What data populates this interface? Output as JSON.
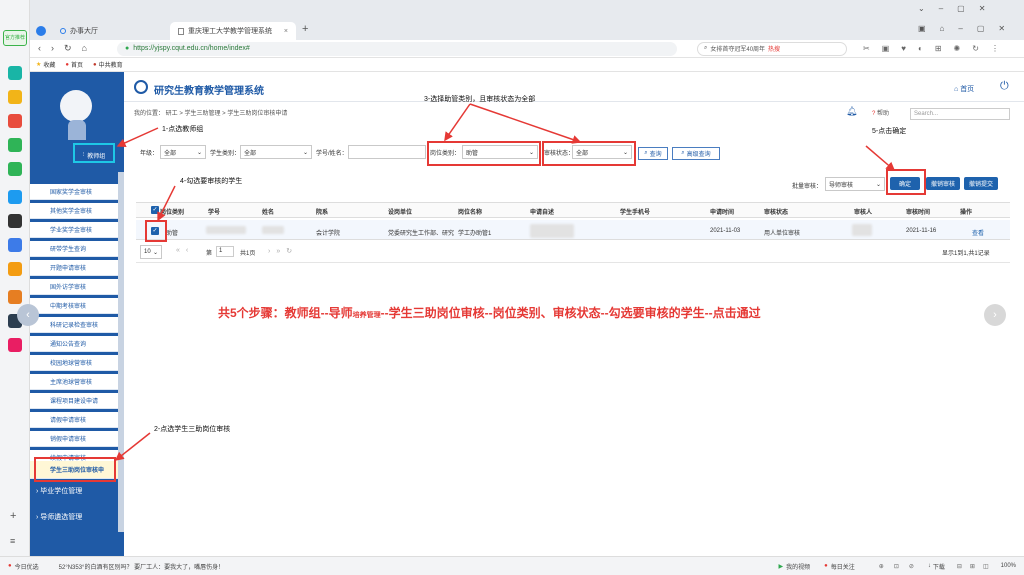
{
  "browser": {
    "tabs": [
      {
        "label": "办事大厅"
      },
      {
        "label": "重庆理工大学教学管理系统"
      }
    ],
    "new_tab": "+",
    "url": "https://yjspy.cqut.edu.cn/home/index#",
    "search_placeholder": "女排首夺冠军40周年",
    "search_badge": "热搜",
    "bookmarks": [
      "收藏",
      "首页",
      "中共教育"
    ],
    "leftbar_label": "官方推荐"
  },
  "sidebar": {
    "role_label": "教师组",
    "items": [
      "国家奖学金审核",
      "其他奖学金审核",
      "学业奖学金审核",
      "研带学生查询",
      "开题申请审核",
      "国外访学审核",
      "中期考核审核",
      "科研记录检查审核",
      "通知公告查询",
      "校园地球营审核",
      "主席池球营审核",
      "课程项目建设申请",
      "请假申请审核",
      "销假申请审核",
      "续假申请审核",
      "学生三助岗位审核申"
    ],
    "sections": [
      "毕业学位管理",
      "导师遴选管理"
    ]
  },
  "header": {
    "title": "研究生教育教学管理系统",
    "home": "首页",
    "help": "帮助",
    "search_placeholder": "Search..."
  },
  "breadcrumb": "我的位置： 研工 > 学生三助管理 > 学生三助岗位审核申请",
  "filters": {
    "grade_label": "年级：",
    "grade_value": "全部",
    "category_label": "学生类别：",
    "category_value": "全部",
    "student_label": "学号/姓名：",
    "post_type_label": "岗位类别：",
    "post_type_value": "助管",
    "status_label": "审核状态：",
    "status_value": "全部",
    "query": "查询",
    "advanced": "高级查询"
  },
  "batch": {
    "label": "批量审核：",
    "select_value": "导师审核",
    "confirm": "确定",
    "revoke_review": "撤销审核",
    "revoke_submit": "撤销提交"
  },
  "table": {
    "headers": [
      "岗位类别",
      "学号",
      "姓名",
      "院系",
      "设岗单位",
      "岗位名称",
      "申请自述",
      "学生手机号",
      "申请时间",
      "审核状态",
      "审核人",
      "审核时间",
      "操作"
    ],
    "row": {
      "post_type": "助管",
      "dept": "会计学院",
      "unit": "党委研究生工作部、研究",
      "position": "学工办助管1",
      "apply_time": "2021-11-03",
      "status": "用人单位审核",
      "review_time": "2021-11-16",
      "action": "查看"
    }
  },
  "pager": {
    "size": "10",
    "page_label": "第",
    "page": "1",
    "total_pages": "共1页",
    "summary": "显示1到1,共1记录"
  },
  "annotations": {
    "a1": "1-点选教师组",
    "a2": "2-点选学生三助岗位审核",
    "a3": "3-选择助管类别，且审核状态为全部",
    "a4": "4-勾选要审核的学生",
    "a5": "5-点击确定",
    "summary_pre": "共5个步骤：教师组--导师",
    "summary_small": "培养管理",
    "summary_post": "--学生三助岗位审核--岗位类别、审核状态--勾选要审核的学生--点击通过"
  },
  "statusbar": {
    "today": "今日优选",
    "news": "52°N353°的白酒有区别吗？   要厂工人：要我大了，嘴唇伤身！",
    "video": "我的视频",
    "hot": "每日关注",
    "download": "下载",
    "zoom": "100%"
  },
  "colors": {
    "sidebar": "#1f5aa6",
    "annotation": "#e53935",
    "primary": "#1e62ad"
  }
}
